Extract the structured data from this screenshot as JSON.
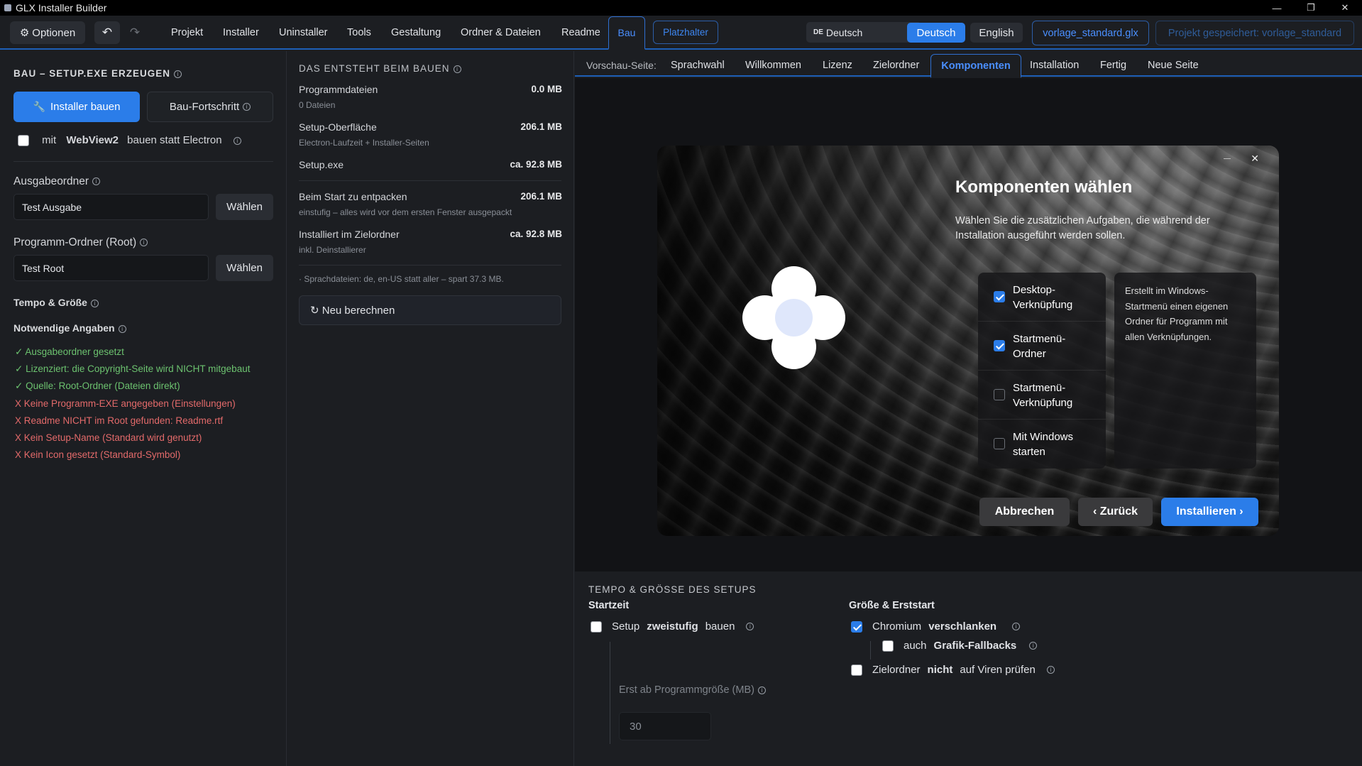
{
  "window": {
    "title": "GLX Installer Builder",
    "controls": [
      "—",
      "❐",
      "✕"
    ]
  },
  "menubar": {
    "options_label": "Optionen",
    "undo": "↶",
    "redo": "↷",
    "items": [
      "Projekt",
      "Installer",
      "Uninstaller",
      "Tools",
      "Gestaltung",
      "Ordner & Dateien",
      "Readme"
    ],
    "active": "Bau",
    "placeholder_btn": "Platzhalter",
    "lang_select": {
      "code": "DE",
      "value": "Deutsch"
    },
    "lang_buttons": [
      "Deutsch",
      "English"
    ],
    "file_btn": "vorlage_standard.glx",
    "saved_btn": "Projekt gespeichert: vorlage_standard"
  },
  "col1": {
    "title": "BAU – SETUP.EXE ERZEUGEN",
    "build_btn": "Installer bauen",
    "progress_btn": "Bau-Fortschritt",
    "webview": {
      "pre": "mit",
      "bold": "WebView2",
      "post": "bauen statt Electron"
    },
    "output_label": "Ausgabeordner",
    "output_value": "Test Ausgabe",
    "choose": "Wählen",
    "root_label": "Programm-Ordner (Root)",
    "root_value": "Test Root",
    "tempo_label": "Tempo & Größe",
    "required_label": "Notwendige Angaben",
    "checks": [
      {
        "icon": "✓",
        "text": "Ausgabeordner gesetzt",
        "ok": true
      },
      {
        "icon": "✓",
        "text": "Lizenziert: die Copyright-Seite wird NICHT mitgebaut",
        "ok": true
      },
      {
        "icon": "✓",
        "text": "Quelle: Root-Ordner (Dateien direkt)",
        "ok": true
      },
      {
        "icon": "X",
        "text": "Keine Programm-EXE angegeben (Einstellungen)",
        "ok": false
      },
      {
        "icon": "X",
        "text": "Readme NICHT im Root gefunden: Readme.rtf",
        "ok": false
      },
      {
        "icon": "X",
        "text": "Kein Setup-Name (Standard wird genutzt)",
        "ok": false
      },
      {
        "icon": "X",
        "text": "Kein Icon gesetzt (Standard-Symbol)",
        "ok": false
      }
    ]
  },
  "col2": {
    "title": "DAS ENTSTEHT BEIM BAUEN",
    "rows": [
      {
        "label": "Programmdateien",
        "sub": "0 Dateien",
        "value": "0.0 MB"
      },
      {
        "label": "Setup-Oberfläche",
        "sub": "Electron-Laufzeit + Installer-Seiten",
        "value": "206.1 MB"
      },
      {
        "label": "Setup.exe",
        "sub": "",
        "value": "ca. 92.8 MB"
      },
      {
        "label": "Beim Start zu entpacken",
        "sub": "einstufig – alles wird vor dem ersten Fenster ausgepackt",
        "value": "206.1 MB"
      },
      {
        "label": "Installiert im Zielordner",
        "sub": "inkl. Deinstallierer",
        "value": "ca. 92.8 MB"
      }
    ],
    "note": "· Sprachdateien: de, en-US statt aller – spart 37.3 MB.",
    "recalc": "↻ Neu berechnen"
  },
  "preview": {
    "label": "Vorschau-Seite:",
    "tabs": [
      "Sprachwahl",
      "Willkommen",
      "Lizenz",
      "Zielordner",
      "Komponenten",
      "Installation",
      "Fertig",
      "Neue Seite"
    ],
    "active_tab": "Komponenten",
    "installer": {
      "min": "—",
      "close": "✕",
      "title": "Komponenten wählen",
      "desc": "Wählen Sie die zusätzlichen Aufgaben, die während der Installation ausgeführt werden sollen.",
      "components": [
        {
          "label": "Desktop-Verknüpfung",
          "line1": "Desktop-",
          "line2": "Verknüpfung",
          "checked": true
        },
        {
          "label": "Startmenü-Ordner",
          "line1": "Startmenü-",
          "line2": "Ordner",
          "checked": true
        },
        {
          "label": "Startmenü-Verknüpfung",
          "line1": "Startmenü-",
          "line2": "Verknüpfung",
          "checked": false
        },
        {
          "label": "Mit Windows starten",
          "line1": "Mit Windows",
          "line2": "starten",
          "checked": false
        }
      ],
      "component_desc": "Erstellt im Windows-Startmenü einen eigenen Ordner für Programm mit allen Verknüpfungen.",
      "cancel": "Abbrechen",
      "back": "‹ Zurück",
      "install": "Installieren ›"
    }
  },
  "bottom": {
    "title": "TEMPO & GRÖSSE DES SETUPS",
    "startzeit": "Startzeit",
    "groesse": "Größe & Erststart",
    "two_stage": {
      "pre": "Setup",
      "bold": "zweistufig",
      "post": "bauen",
      "checked": false
    },
    "threshold_label": "Erst ab Programmgröße (MB)",
    "threshold_value": "30",
    "chromium": {
      "pre": "Chromium",
      "bold": "verschlanken",
      "post": "",
      "checked": true
    },
    "fallbacks": {
      "pre": "auch",
      "bold": "Grafik-Fallbacks",
      "post": "",
      "checked": false
    },
    "virus": {
      "pre": "Zielordner",
      "bold": "nicht",
      "post": "auf Viren prüfen",
      "checked": false
    }
  }
}
